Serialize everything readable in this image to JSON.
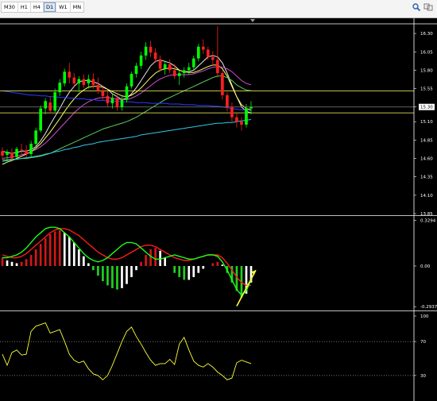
{
  "toolbar": {
    "timeframes": [
      "M30",
      "H1",
      "H4",
      "D1",
      "W1",
      "MN"
    ],
    "active_timeframe": "D1",
    "icons": [
      "search-icon",
      "compare-icon"
    ]
  },
  "chart_data": [
    {
      "type": "candlestick",
      "panel": "price",
      "yticks": [
        16.3,
        16.05,
        15.8,
        15.55,
        15.3,
        15.1,
        14.85,
        14.6,
        14.35,
        14.1,
        13.85
      ],
      "ylim": [
        13.85,
        16.42
      ],
      "current_price_label": "15.30",
      "up_color": "#00ff00",
      "down_color": "#ff2020",
      "candles": [
        [
          14.7,
          14.75,
          14.58,
          14.64
        ],
        [
          14.65,
          14.72,
          14.55,
          14.69
        ],
        [
          14.68,
          14.74,
          14.57,
          14.6
        ],
        [
          14.62,
          14.76,
          14.6,
          14.73
        ],
        [
          14.72,
          14.8,
          14.66,
          14.71
        ],
        [
          14.71,
          14.78,
          14.62,
          14.66
        ],
        [
          14.66,
          14.84,
          14.62,
          14.8
        ],
        [
          14.8,
          15.02,
          14.76,
          14.98
        ],
        [
          14.98,
          15.32,
          14.95,
          15.28
        ],
        [
          15.28,
          15.42,
          15.2,
          15.38
        ],
        [
          15.36,
          15.44,
          15.22,
          15.25
        ],
        [
          15.25,
          15.55,
          15.23,
          15.5
        ],
        [
          15.5,
          15.68,
          15.45,
          15.63
        ],
        [
          15.62,
          15.82,
          15.58,
          15.78
        ],
        [
          15.78,
          15.9,
          15.62,
          15.7
        ],
        [
          15.7,
          15.76,
          15.58,
          15.62
        ],
        [
          15.62,
          15.72,
          15.5,
          15.68
        ],
        [
          15.68,
          15.74,
          15.56,
          15.6
        ],
        [
          15.62,
          15.74,
          15.55,
          15.68
        ],
        [
          15.68,
          15.76,
          15.55,
          15.6
        ],
        [
          15.6,
          15.7,
          15.48,
          15.52
        ],
        [
          15.52,
          15.58,
          15.4,
          15.45
        ],
        [
          15.45,
          15.52,
          15.3,
          15.35
        ],
        [
          15.35,
          15.48,
          15.28,
          15.42
        ],
        [
          15.42,
          15.46,
          15.25,
          15.3
        ],
        [
          15.3,
          15.44,
          15.25,
          15.4
        ],
        [
          15.4,
          15.62,
          15.36,
          15.58
        ],
        [
          15.58,
          15.78,
          15.55,
          15.75
        ],
        [
          15.75,
          15.9,
          15.7,
          15.86
        ],
        [
          15.86,
          16.05,
          15.82,
          16.0
        ],
        [
          16.0,
          16.18,
          15.94,
          16.12
        ],
        [
          16.12,
          16.2,
          15.98,
          16.04
        ],
        [
          16.04,
          16.1,
          15.9,
          15.95
        ],
        [
          15.95,
          16.0,
          15.78,
          15.82
        ],
        [
          15.82,
          15.92,
          15.74,
          15.88
        ],
        [
          15.88,
          15.95,
          15.76,
          15.8
        ],
        [
          15.8,
          15.88,
          15.68,
          15.72
        ],
        [
          15.72,
          15.8,
          15.6,
          15.76
        ],
        [
          15.76,
          15.84,
          15.7,
          15.8
        ],
        [
          15.8,
          15.9,
          15.74,
          15.84
        ],
        [
          15.84,
          16.0,
          15.8,
          15.96
        ],
        [
          15.96,
          16.16,
          15.92,
          16.12
        ],
        [
          16.12,
          16.22,
          16.02,
          16.08
        ],
        [
          16.08,
          16.12,
          15.94,
          15.98
        ],
        [
          15.98,
          16.06,
          15.86,
          15.94
        ],
        [
          15.94,
          16.4,
          15.7,
          15.76
        ],
        [
          15.76,
          15.8,
          15.4,
          15.46
        ],
        [
          15.46,
          15.5,
          15.24,
          15.3
        ],
        [
          15.3,
          15.36,
          15.1,
          15.16
        ],
        [
          15.16,
          15.22,
          15.02,
          15.1
        ],
        [
          15.1,
          15.16,
          14.98,
          15.06
        ],
        [
          15.06,
          15.34,
          15.02,
          15.28
        ],
        [
          15.28,
          15.38,
          15.2,
          15.3
        ]
      ],
      "overlays": [
        {
          "name": "MA-white",
          "color": "#e8e8e8",
          "values": [
            14.7,
            14.68,
            14.67,
            14.68,
            14.7,
            14.7,
            14.72,
            14.76,
            14.84,
            14.94,
            15.06,
            15.17,
            15.28,
            15.4,
            15.5,
            15.58,
            15.64,
            15.66,
            15.66,
            15.64,
            15.62,
            15.58,
            15.54,
            15.48,
            15.44,
            15.4,
            15.42,
            15.48,
            15.56,
            15.66,
            15.76,
            15.86,
            15.92,
            15.94,
            15.92,
            15.9,
            15.86,
            15.8,
            15.78,
            15.78,
            15.8,
            15.86,
            15.92,
            15.98,
            16.0,
            15.98,
            15.9,
            15.76,
            15.6,
            15.44,
            15.3,
            15.24,
            15.22
          ]
        },
        {
          "name": "MA-yellow",
          "color": "#ffff66",
          "values": [
            14.52,
            14.55,
            14.57,
            14.6,
            14.63,
            14.66,
            14.69,
            14.74,
            14.8,
            14.88,
            14.96,
            15.05,
            15.14,
            15.24,
            15.33,
            15.41,
            15.48,
            15.53,
            15.57,
            15.58,
            15.58,
            15.57,
            15.54,
            15.51,
            15.48,
            15.45,
            15.44,
            15.46,
            15.5,
            15.56,
            15.63,
            15.7,
            15.76,
            15.8,
            15.82,
            15.83,
            15.82,
            15.8,
            15.78,
            15.77,
            15.77,
            15.79,
            15.82,
            15.85,
            15.87,
            15.87,
            15.82,
            15.72,
            15.58,
            15.44,
            15.33,
            15.28,
            15.26
          ]
        },
        {
          "name": "MA-magenta",
          "color": "#d24ad2",
          "values": [
            14.6,
            14.61,
            14.62,
            14.63,
            14.65,
            14.67,
            14.69,
            14.72,
            14.76,
            14.81,
            14.87,
            14.94,
            15.01,
            15.08,
            15.15,
            15.22,
            15.28,
            15.33,
            15.37,
            15.4,
            15.42,
            15.43,
            15.43,
            15.42,
            15.41,
            15.4,
            15.4,
            15.42,
            15.45,
            15.49,
            15.54,
            15.59,
            15.64,
            15.68,
            15.71,
            15.73,
            15.74,
            15.74,
            15.74,
            15.74,
            15.75,
            15.77,
            15.79,
            15.82,
            15.84,
            15.85,
            15.84,
            15.82,
            15.78,
            15.72,
            15.66,
            15.62,
            15.6
          ]
        },
        {
          "name": "MA-green",
          "color": "#5ad05a",
          "values": [
            14.58,
            14.58,
            14.59,
            14.59,
            14.6,
            14.6,
            14.61,
            14.62,
            14.63,
            14.65,
            14.67,
            14.7,
            14.73,
            14.76,
            14.79,
            14.82,
            14.85,
            14.88,
            14.91,
            14.94,
            14.97,
            15.0,
            15.02,
            15.04,
            15.06,
            15.08,
            15.1,
            15.13,
            15.16,
            15.2,
            15.24,
            15.28,
            15.32,
            15.36,
            15.4,
            15.43,
            15.46,
            15.49,
            15.52,
            15.55,
            15.58,
            15.61,
            15.64,
            15.67,
            15.7,
            15.72,
            15.72,
            15.7,
            15.66,
            15.6,
            15.56,
            15.53,
            15.52
          ]
        },
        {
          "name": "MA-blue",
          "color": "#2c3cff",
          "values": [
            15.52,
            15.51,
            15.5,
            15.49,
            15.48,
            15.47,
            15.46,
            15.46,
            15.45,
            15.45,
            15.44,
            15.44,
            15.43,
            15.43,
            15.42,
            15.42,
            15.41,
            15.41,
            15.4,
            15.4,
            15.39,
            15.39,
            15.38,
            15.38,
            15.38,
            15.37,
            15.37,
            15.37,
            15.36,
            15.36,
            15.36,
            15.35,
            15.35,
            15.35,
            15.35,
            15.34,
            15.34,
            15.34,
            15.33,
            15.33,
            15.33,
            15.32,
            15.32,
            15.32,
            15.31,
            15.31,
            15.3,
            15.29,
            15.28,
            15.27,
            15.26,
            15.26,
            15.25
          ]
        },
        {
          "name": "MA-cyan",
          "color": "#33c7e8",
          "values": [
            14.56,
            14.57,
            14.58,
            14.59,
            14.6,
            14.61,
            14.62,
            14.63,
            14.64,
            14.66,
            14.67,
            14.69,
            14.7,
            14.72,
            14.73,
            14.75,
            14.76,
            14.78,
            14.79,
            14.8,
            14.82,
            14.83,
            14.84,
            14.85,
            14.86,
            14.87,
            14.88,
            14.89,
            14.9,
            14.92,
            14.93,
            14.94,
            14.95,
            14.96,
            14.97,
            14.98,
            14.99,
            15.0,
            15.01,
            15.02,
            15.03,
            15.04,
            15.05,
            15.06,
            15.07,
            15.08,
            15.08,
            15.09,
            15.09,
            15.1,
            15.11,
            15.12,
            15.13
          ]
        }
      ],
      "hlines": [
        {
          "value": 15.52,
          "color": "#ffff66"
        },
        {
          "value": 15.22,
          "color": "#ffff66"
        },
        {
          "value": 15.3,
          "color": "#808080"
        }
      ]
    },
    {
      "type": "histogram",
      "panel": "oscillator",
      "yticks": [
        0.3294,
        0.0,
        -0.2937
      ],
      "ytick_labels": [
        "0.3294",
        "0.00",
        "-0.2937"
      ],
      "ylim": [
        -0.31,
        0.35
      ],
      "histogram": [
        0.06,
        0.04,
        0.03,
        0.02,
        0.03,
        0.05,
        0.08,
        0.12,
        0.16,
        0.2,
        0.23,
        0.25,
        0.26,
        0.24,
        0.21,
        0.17,
        0.12,
        0.07,
        0.02,
        -0.03,
        -0.07,
        -0.11,
        -0.14,
        -0.16,
        -0.17,
        -0.16,
        -0.13,
        -0.08,
        -0.03,
        0.03,
        0.08,
        0.12,
        0.13,
        0.11,
        0.06,
        0.0,
        -0.05,
        -0.08,
        -0.1,
        -0.1,
        -0.08,
        -0.05,
        -0.02,
        0.0,
        0.02,
        0.03,
        0.01,
        -0.05,
        -0.12,
        -0.18,
        -0.23,
        -0.2,
        -0.12
      ],
      "histogram_colors": {
        "rising_pos": "#ffffff",
        "falling_pos": "#d01818",
        "rising_neg": "#ffffff",
        "falling_neg": "#20d020"
      },
      "series": [
        {
          "name": "signal-red",
          "color": "#ff1a1a",
          "values": [
            0.08,
            0.07,
            0.06,
            0.06,
            0.07,
            0.09,
            0.12,
            0.15,
            0.18,
            0.21,
            0.24,
            0.26,
            0.27,
            0.27,
            0.26,
            0.24,
            0.22,
            0.19,
            0.16,
            0.13,
            0.1,
            0.08,
            0.06,
            0.05,
            0.05,
            0.06,
            0.08,
            0.1,
            0.12,
            0.14,
            0.15,
            0.15,
            0.14,
            0.12,
            0.1,
            0.08,
            0.06,
            0.05,
            0.04,
            0.04,
            0.05,
            0.06,
            0.07,
            0.08,
            0.08,
            0.08,
            0.06,
            0.02,
            -0.03,
            -0.08,
            -0.12,
            -0.14,
            -0.14
          ]
        },
        {
          "name": "main-green",
          "color": "#1aff1a",
          "values": [
            0.06,
            0.06,
            0.07,
            0.08,
            0.1,
            0.13,
            0.17,
            0.21,
            0.24,
            0.27,
            0.28,
            0.28,
            0.27,
            0.24,
            0.21,
            0.17,
            0.13,
            0.09,
            0.06,
            0.04,
            0.03,
            0.04,
            0.06,
            0.09,
            0.12,
            0.15,
            0.17,
            0.17,
            0.16,
            0.13,
            0.1,
            0.07,
            0.05,
            0.05,
            0.06,
            0.07,
            0.08,
            0.07,
            0.06,
            0.05,
            0.05,
            0.06,
            0.07,
            0.08,
            0.08,
            0.07,
            0.03,
            -0.03,
            -0.1,
            -0.17,
            -0.21,
            -0.18,
            -0.1
          ]
        }
      ],
      "trendline": {
        "color": "#ffff33",
        "from": [
          49,
          -0.29
        ],
        "to": [
          53,
          -0.03
        ]
      }
    },
    {
      "type": "line",
      "panel": "oscillator",
      "yticks": [
        100,
        70,
        30
      ],
      "ytick_labels": [
        "100",
        "70",
        "30"
      ],
      "ylim": [
        0,
        100
      ],
      "levels": [
        70,
        30
      ],
      "series": [
        {
          "name": "oscillator-yellow",
          "color": "#ffff33",
          "values": [
            55,
            42,
            57,
            60,
            54,
            55,
            82,
            88,
            90,
            92,
            80,
            82,
            84,
            70,
            55,
            48,
            45,
            47,
            38,
            32,
            30,
            25,
            30,
            42,
            56,
            70,
            82,
            87,
            76,
            67,
            57,
            48,
            42,
            44,
            44,
            49,
            43,
            67,
            75,
            60,
            47,
            42,
            40,
            44,
            40,
            34,
            30,
            25,
            27,
            45,
            48,
            46,
            44
          ]
        }
      ]
    }
  ]
}
